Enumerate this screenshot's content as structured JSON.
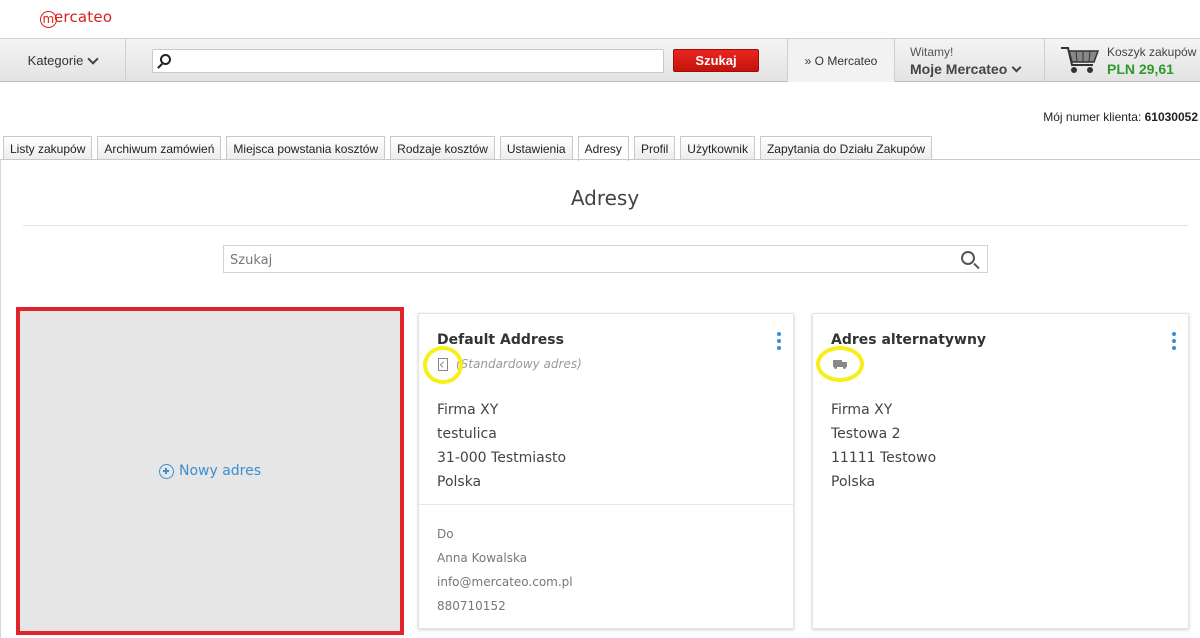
{
  "brand": {
    "logo_text": "ercateo",
    "logo_letter": "m",
    "accent": "#d9201e"
  },
  "header": {
    "categories_label": "Kategorie",
    "search_value": "",
    "search_button": "Szukaj",
    "about_link": "» O Mercateo",
    "greeting": "Witamy!",
    "account_menu": "Moje Mercateo",
    "cart_label": "Koszyk zakupów",
    "cart_total": "PLN 29,61"
  },
  "client": {
    "label": "Mój numer klienta:",
    "number": "61030052"
  },
  "tabs": [
    {
      "label": "Listy zakupów",
      "active": false
    },
    {
      "label": "Archiwum zamówień",
      "active": false
    },
    {
      "label": "Miejsca powstania kosztów",
      "active": false
    },
    {
      "label": "Rodzaje kosztów",
      "active": false
    },
    {
      "label": "Ustawienia",
      "active": false
    },
    {
      "label": "Adresy",
      "active": true
    },
    {
      "label": "Profil",
      "active": false
    },
    {
      "label": "Użytkownik",
      "active": false
    },
    {
      "label": "Zapytania do Działu Zakupów",
      "active": false
    }
  ],
  "page": {
    "title": "Adresy",
    "search_placeholder": "Szukaj",
    "new_address_label": "Nowy adres"
  },
  "addresses": [
    {
      "name": "Default Address",
      "subtitle": "(Standardowy adres)",
      "icon": "document-icon",
      "lines": [
        "Firma XY",
        "testulica",
        "31-000 Testmiasto",
        "Polska"
      ],
      "contact": [
        "Do",
        "Anna Kowalska",
        "info@mercateo.com.pl",
        "880710152"
      ]
    },
    {
      "name": "Adres alternatywny",
      "subtitle": "",
      "icon": "truck-icon",
      "lines": [
        "Firma XY",
        "Testowa 2",
        "11111 Testowo",
        "Polska"
      ],
      "contact": []
    }
  ],
  "colors": {
    "highlight_frame": "#e0242b",
    "highlight_ring": "#f7ee1a",
    "link": "#3a8fd1",
    "price": "#2e9a2e"
  }
}
